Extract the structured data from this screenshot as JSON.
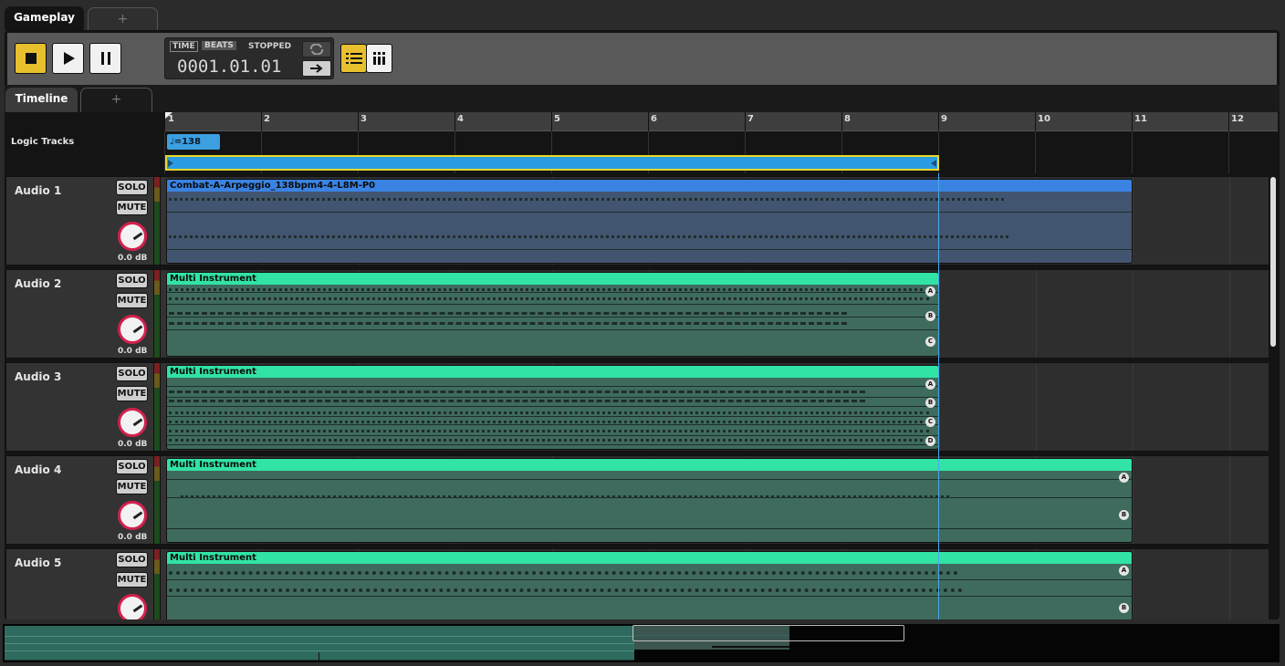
{
  "tabs": [
    {
      "label": "Gameplay"
    },
    {
      "label": "+"
    }
  ],
  "subtabs": [
    {
      "label": "Timeline"
    },
    {
      "label": "+"
    }
  ],
  "transport": {
    "time_label": "TIME",
    "beats_label": "BEATS",
    "state": "STOPPED",
    "position": "0001.01.01"
  },
  "ruler": {
    "bars": [
      "1",
      "2",
      "3",
      "4",
      "5",
      "6",
      "7",
      "8",
      "9",
      "10",
      "11",
      "12"
    ]
  },
  "logic": {
    "label": "Logic Tracks",
    "tempo": "♩=138 4/4"
  },
  "tracks": [
    {
      "name": "Audio 1",
      "solo": "SOLO",
      "mute": "MUTE",
      "gain": "0.0 dB",
      "clip": "Combat-A-Arpeggio_138bpm4-4-L8M-P0",
      "markers": []
    },
    {
      "name": "Audio 2",
      "solo": "SOLO",
      "mute": "MUTE",
      "gain": "0.0 dB",
      "clip": "Multi Instrument",
      "markers": [
        "A",
        "B",
        "C"
      ]
    },
    {
      "name": "Audio 3",
      "solo": "SOLO",
      "mute": "MUTE",
      "gain": "0.0 dB",
      "clip": "Multi Instrument",
      "markers": [
        "A",
        "B",
        "C",
        "D"
      ]
    },
    {
      "name": "Audio 4",
      "solo": "SOLO",
      "mute": "MUTE",
      "gain": "0.0 dB",
      "clip": "Multi Instrument",
      "markers": [
        "A",
        "B"
      ]
    },
    {
      "name": "Audio 5",
      "solo": "SOLO",
      "mute": "MUTE",
      "gain": "",
      "clip": "Multi Instrument",
      "markers": [
        "A",
        "B"
      ]
    }
  ],
  "colors": {
    "accent": "#e8c02e",
    "clip_blue": "#3a83e3",
    "clip_green": "#31e3a4",
    "tempo": "#3b9fe0",
    "knob_ring": "#d2214d"
  },
  "icons": {
    "stop": "stop-icon",
    "play": "play-icon",
    "pause": "pause-icon",
    "loop": "loop-icon",
    "arrow": "arrow-right-icon",
    "list": "list-view-icon",
    "grid": "bars-view-icon"
  }
}
